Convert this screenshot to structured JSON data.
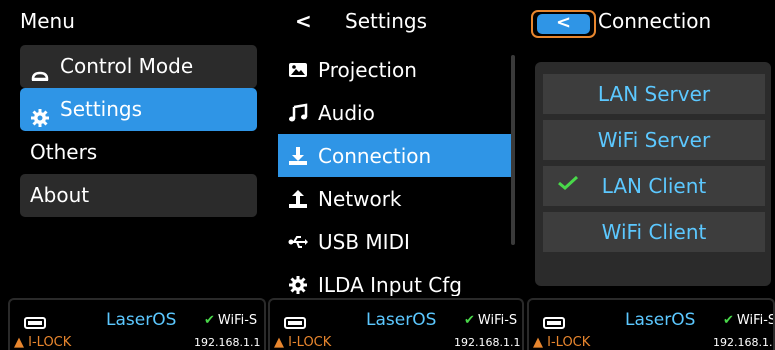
{
  "menu": {
    "title": "Menu",
    "items": [
      {
        "label": "Control Mode",
        "icon": "cloud-icon"
      },
      {
        "label": "Settings",
        "icon": "gear-icon"
      },
      {
        "label": "Others",
        "icon": ""
      },
      {
        "label": "About",
        "icon": ""
      }
    ],
    "selected_index": 1
  },
  "settings": {
    "back_glyph": "<",
    "title": "Settings",
    "items": [
      {
        "label": "Projection",
        "icon": "image-icon"
      },
      {
        "label": "Audio",
        "icon": "music-note-icon"
      },
      {
        "label": "Connection",
        "icon": "download-icon"
      },
      {
        "label": "Network",
        "icon": "upload-icon"
      },
      {
        "label": "USB MIDI",
        "icon": "usb-icon"
      },
      {
        "label": "ILDA Input Cfg",
        "icon": "gear-icon"
      }
    ],
    "selected_index": 2
  },
  "connection": {
    "back_glyph": "<",
    "title": "Connection",
    "options": [
      {
        "label": "LAN Server",
        "checked": false
      },
      {
        "label": "WiFi Server",
        "checked": false
      },
      {
        "label": "LAN Client",
        "checked": true
      },
      {
        "label": "WiFi Client",
        "checked": false
      }
    ]
  },
  "status_bars": [
    {
      "name": "LaserOS",
      "wifi": "WiFi-S",
      "lock": "I-LOCK",
      "ip": "192.168.1.1"
    },
    {
      "name": "LaserOS",
      "wifi": "WiFi-S",
      "lock": "I-LOCK",
      "ip": "192.168.1.1"
    },
    {
      "name": "LaserOS",
      "wifi": "WiFi-S",
      "lock": "I-LOCK",
      "ip": "192.168.1.1"
    }
  ],
  "colors": {
    "accent": "#2f95e6",
    "option_text": "#5cc8ff",
    "focus_border": "#e8862e",
    "check": "#49d84a",
    "panel_item_bg": "#2b2b2b"
  }
}
